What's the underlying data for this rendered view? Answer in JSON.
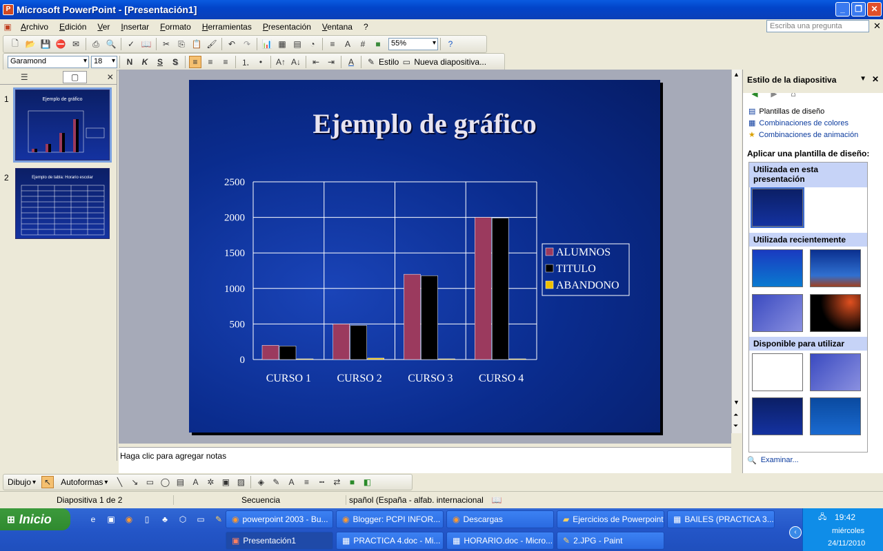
{
  "window": {
    "title": "Microsoft PowerPoint - [Presentación1]",
    "icon": "powerpoint-icon"
  },
  "menu": {
    "items": [
      "Archivo",
      "Edición",
      "Ver",
      "Insertar",
      "Formato",
      "Herramientas",
      "Presentación",
      "Ventana",
      "?"
    ],
    "ask_placeholder": "Escriba una pregunta"
  },
  "toolbar": {
    "zoom": "55%",
    "font": "Garamond",
    "size": "18",
    "bold": "N",
    "italic": "K",
    "underline": "S",
    "shadow": "S",
    "style_label": "Estilo",
    "new_slide_label": "Nueva diapositiva..."
  },
  "slides": [
    {
      "num": "1",
      "title": "Ejemplo de gráfico"
    },
    {
      "num": "2",
      "title": "Ejemplo de tabla: Horario escolar"
    }
  ],
  "slide": {
    "title": "Ejemplo de gráfico"
  },
  "chart_data": {
    "type": "bar",
    "title": "Ejemplo de gráfico",
    "categories": [
      "CURSO 1",
      "CURSO 2",
      "CURSO 3",
      "CURSO 4"
    ],
    "series": [
      {
        "name": "ALUMNOS",
        "values": [
          200,
          500,
          1200,
          2000
        ],
        "color": "#9b3a5e"
      },
      {
        "name": "TITULO",
        "values": [
          190,
          480,
          1180,
          1990
        ],
        "color": "#000000"
      },
      {
        "name": "ABANDONO",
        "values": [
          10,
          20,
          10,
          10
        ],
        "color": "#f0c000"
      }
    ],
    "yticks": [
      "0",
      "500",
      "1000",
      "1500",
      "2000",
      "2500"
    ],
    "ylim": [
      0,
      2500
    ],
    "grid": true,
    "legend": "right"
  },
  "notes": {
    "placeholder": "Haga clic para agregar notas"
  },
  "taskpane": {
    "title": "Estilo de la diapositiva",
    "links": [
      "Plantillas de diseño",
      "Combinaciones de colores",
      "Combinaciones de animación"
    ],
    "apply_label": "Aplicar una plantilla de diseño:",
    "sections": [
      "Utilizada en esta presentación",
      "Utilizada recientemente",
      "Disponible para utilizar"
    ],
    "browse": "Examinar..."
  },
  "drawbar": {
    "draw": "Dibujo",
    "autoshapes": "Autoformas"
  },
  "status": {
    "slide": "Diapositiva 1 de 2",
    "design": "Secuencia",
    "language": "spañol (España - alfab. internacional"
  },
  "taskbar": {
    "start": "Inicio",
    "tasks_row1": [
      "powerpoint 2003 - Bu...",
      "Blogger: PCPI INFOR...",
      "Descargas",
      "Ejercicios de Powerpoint",
      "BAILES (PRACTICA 3..."
    ],
    "tasks_row2": [
      "Presentación1",
      "PRACTICA 4.doc - Mi...",
      "HORARIO.doc - Micro...",
      "2.JPG - Paint"
    ],
    "time": "19:42",
    "day": "miércoles",
    "date": "24/11/2010"
  }
}
